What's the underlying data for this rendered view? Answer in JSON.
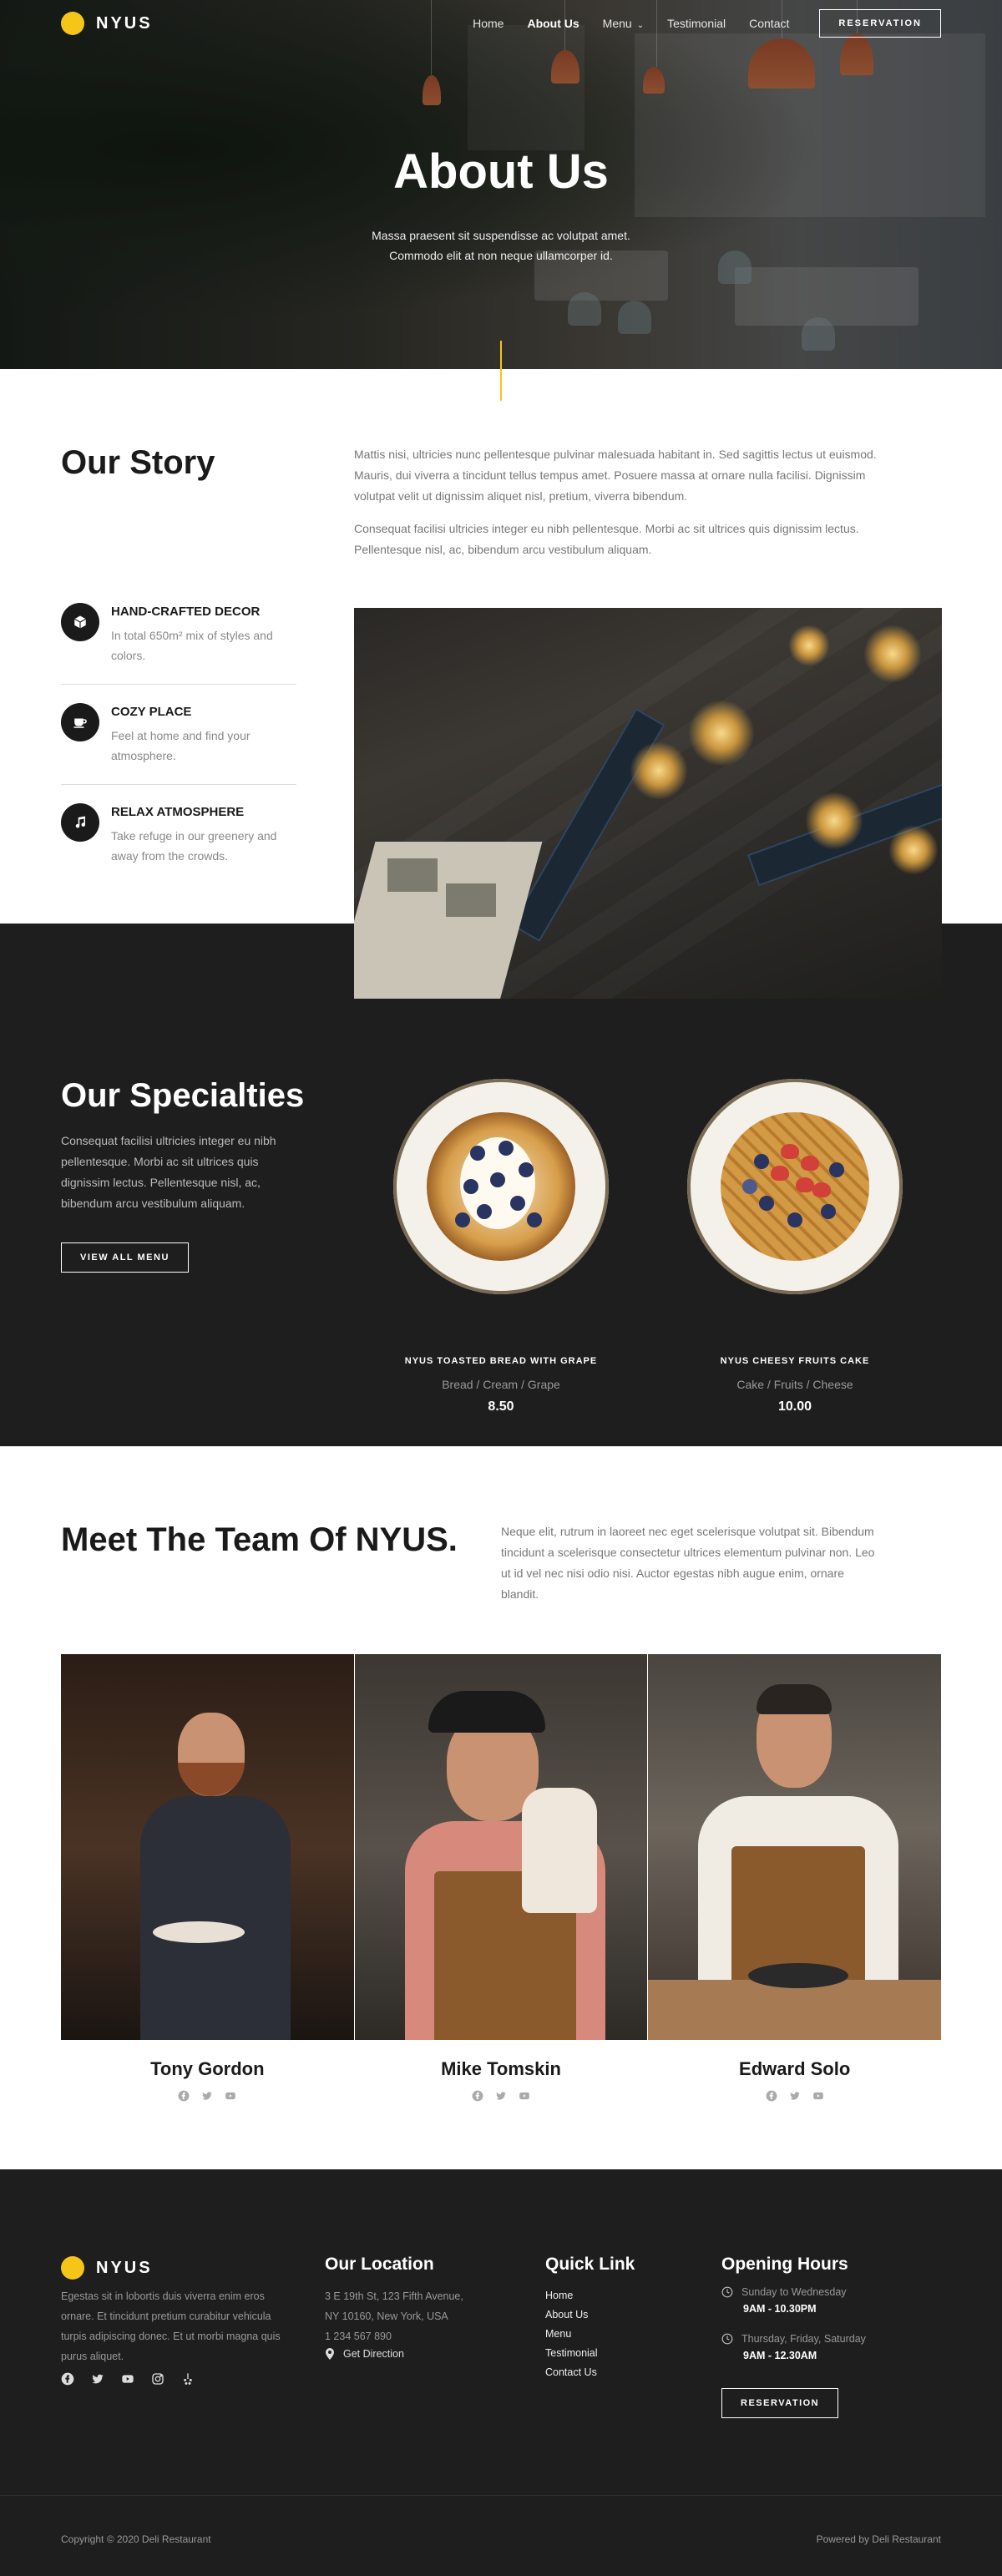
{
  "brand": {
    "name": "NYUS",
    "accent": "#f5c518"
  },
  "nav": {
    "items": [
      {
        "label": "Home"
      },
      {
        "label": "About Us",
        "active": true
      },
      {
        "label": "Menu",
        "has_dropdown": true
      },
      {
        "label": "Testimonial"
      },
      {
        "label": "Contact"
      }
    ],
    "cta": "RESERVATION"
  },
  "hero": {
    "title": "About Us",
    "subtitle_line1": "Massa praesent sit suspendisse ac volutpat amet.",
    "subtitle_line2": "Commodo elit at non neque ullamcorper id."
  },
  "story": {
    "title": "Our Story",
    "paragraph1": "Mattis nisi, ultricies nunc pellentesque pulvinar malesuada habitant in. Sed sagittis lectus ut euismod. Mauris, dui viverra a tincidunt tellus tempus amet. Posuere massa at ornare nulla facilisi. Dignissim volutpat velit ut dignissim aliquet nisl, pretium, viverra bibendum.",
    "paragraph2": "Consequat facilisi ultricies integer eu nibh pellentesque. Morbi ac sit ultrices quis dignissim lectus. Pellentesque nisl, ac, bibendum arcu vestibulum aliquam.",
    "features": [
      {
        "icon": "cube-icon",
        "title": "HAND-CRAFTED DECOR",
        "desc": "In total 650m² mix of styles and colors."
      },
      {
        "icon": "coffee-cup-icon",
        "title": "COZY PLACE",
        "desc": "Feel at home and find your atmosphere."
      },
      {
        "icon": "music-note-icon",
        "title": "RELAX ATMOSPHERE",
        "desc": "Take refuge in our greenery and away from the crowds."
      }
    ]
  },
  "specialties": {
    "title": "Our Specialties",
    "text": "Consequat facilisi ultricies integer eu nibh pellentesque. Morbi ac sit ultrices quis dignissim lectus. Pellentesque nisl, ac, bibendum arcu vestibulum aliquam.",
    "button": "VIEW ALL MENU",
    "dishes": [
      {
        "name": "NYUS TOASTED BREAD WITH GRAPE",
        "tags": "Bread / Cream / Grape",
        "price": "8.50"
      },
      {
        "name": "NYUS CHEESY FRUITS CAKE",
        "tags": "Cake / Fruits / Cheese",
        "price": "10.00"
      }
    ]
  },
  "team": {
    "title": "Meet The Team Of NYUS.",
    "text": "Neque elit, rutrum in laoreet nec eget scelerisque volutpat sit. Bibendum tincidunt a scelerisque consectetur ultrices elementum pulvinar non. Leo ut id vel nec nisi odio nisi. Auctor egestas nibh augue enim, ornare blandit.",
    "members": [
      {
        "name": "Tony Gordon"
      },
      {
        "name": "Mike Tomskin"
      },
      {
        "name": "Edward Solo"
      }
    ]
  },
  "footer": {
    "about": "Egestas sit in lobortis duis viverra enim eros ornare. Et tincidunt pretium curabitur vehicula turpis adipiscing donec. Et ut morbi magna quis purus aliquet.",
    "location": {
      "heading": "Our Location",
      "line1": "3 E 19th St, 123 Fifth Avenue,",
      "line2": "NY 10160, New York, USA",
      "phone": "1 234 567 890",
      "direction": "Get Direction"
    },
    "quick_links": {
      "heading": "Quick Link",
      "items": [
        "Home",
        "About Us",
        "Menu",
        "Testimonial",
        "Contact Us"
      ]
    },
    "hours": {
      "heading": "Opening Hours",
      "slots": [
        {
          "days": "Sunday to Wednesday",
          "time": "9AM - 10.30PM"
        },
        {
          "days": "Thursday, Friday, Saturday",
          "time": "9AM - 12.30AM"
        }
      ],
      "button": "RESERVATION"
    },
    "copyright": "Copyright © 2020 Deli Restaurant",
    "powered": "Powered by Deli Restaurant"
  }
}
